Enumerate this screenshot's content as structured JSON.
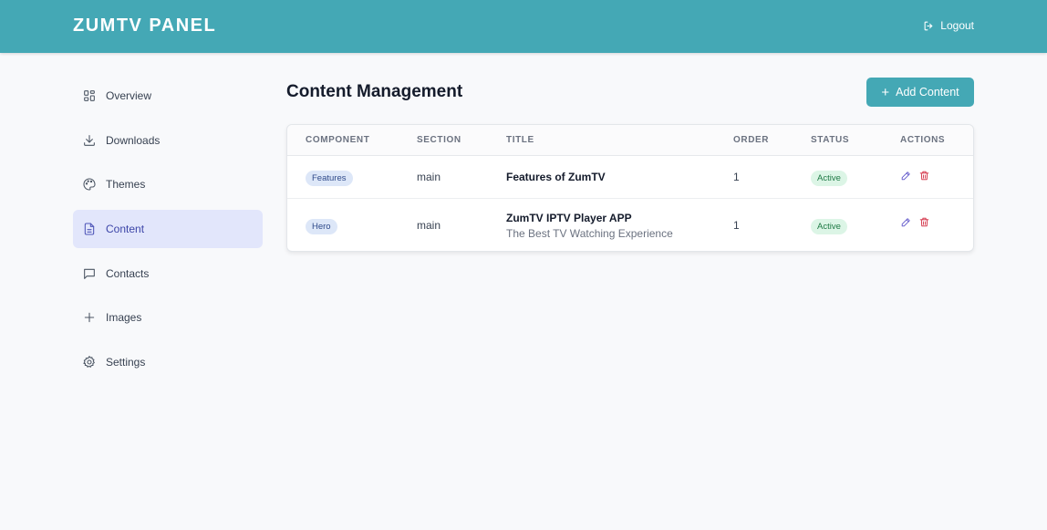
{
  "header": {
    "brand": "ZUMTV PANEL",
    "logout_label": "Logout"
  },
  "sidebar": {
    "items": [
      {
        "label": "Overview",
        "icon": "grid-icon",
        "active": false
      },
      {
        "label": "Downloads",
        "icon": "download-icon",
        "active": false
      },
      {
        "label": "Themes",
        "icon": "palette-icon",
        "active": false
      },
      {
        "label": "Content",
        "icon": "document-icon",
        "active": true
      },
      {
        "label": "Contacts",
        "icon": "message-icon",
        "active": false
      },
      {
        "label": "Images",
        "icon": "plus-icon",
        "active": false
      },
      {
        "label": "Settings",
        "icon": "gear-icon",
        "active": false
      }
    ]
  },
  "main": {
    "title": "Content Management",
    "add_button_label": "Add Content",
    "table": {
      "headers": [
        "COMPONENT",
        "SECTION",
        "TITLE",
        "ORDER",
        "STATUS",
        "ACTIONS"
      ],
      "rows": [
        {
          "component": "Features",
          "section": "main",
          "title": "Features of ZumTV",
          "subtitle": "",
          "order": "1",
          "status": "Active"
        },
        {
          "component": "Hero",
          "section": "main",
          "title": "ZumTV IPTV Player APP",
          "subtitle": "The Best TV Watching Experience",
          "order": "1",
          "status": "Active"
        }
      ]
    }
  },
  "colors": {
    "accent": "#44a8b5",
    "active_nav_bg": "#e2e6fb",
    "status_active_bg": "#dcf5e6",
    "edit": "#5b52c9",
    "delete": "#d0243a"
  }
}
